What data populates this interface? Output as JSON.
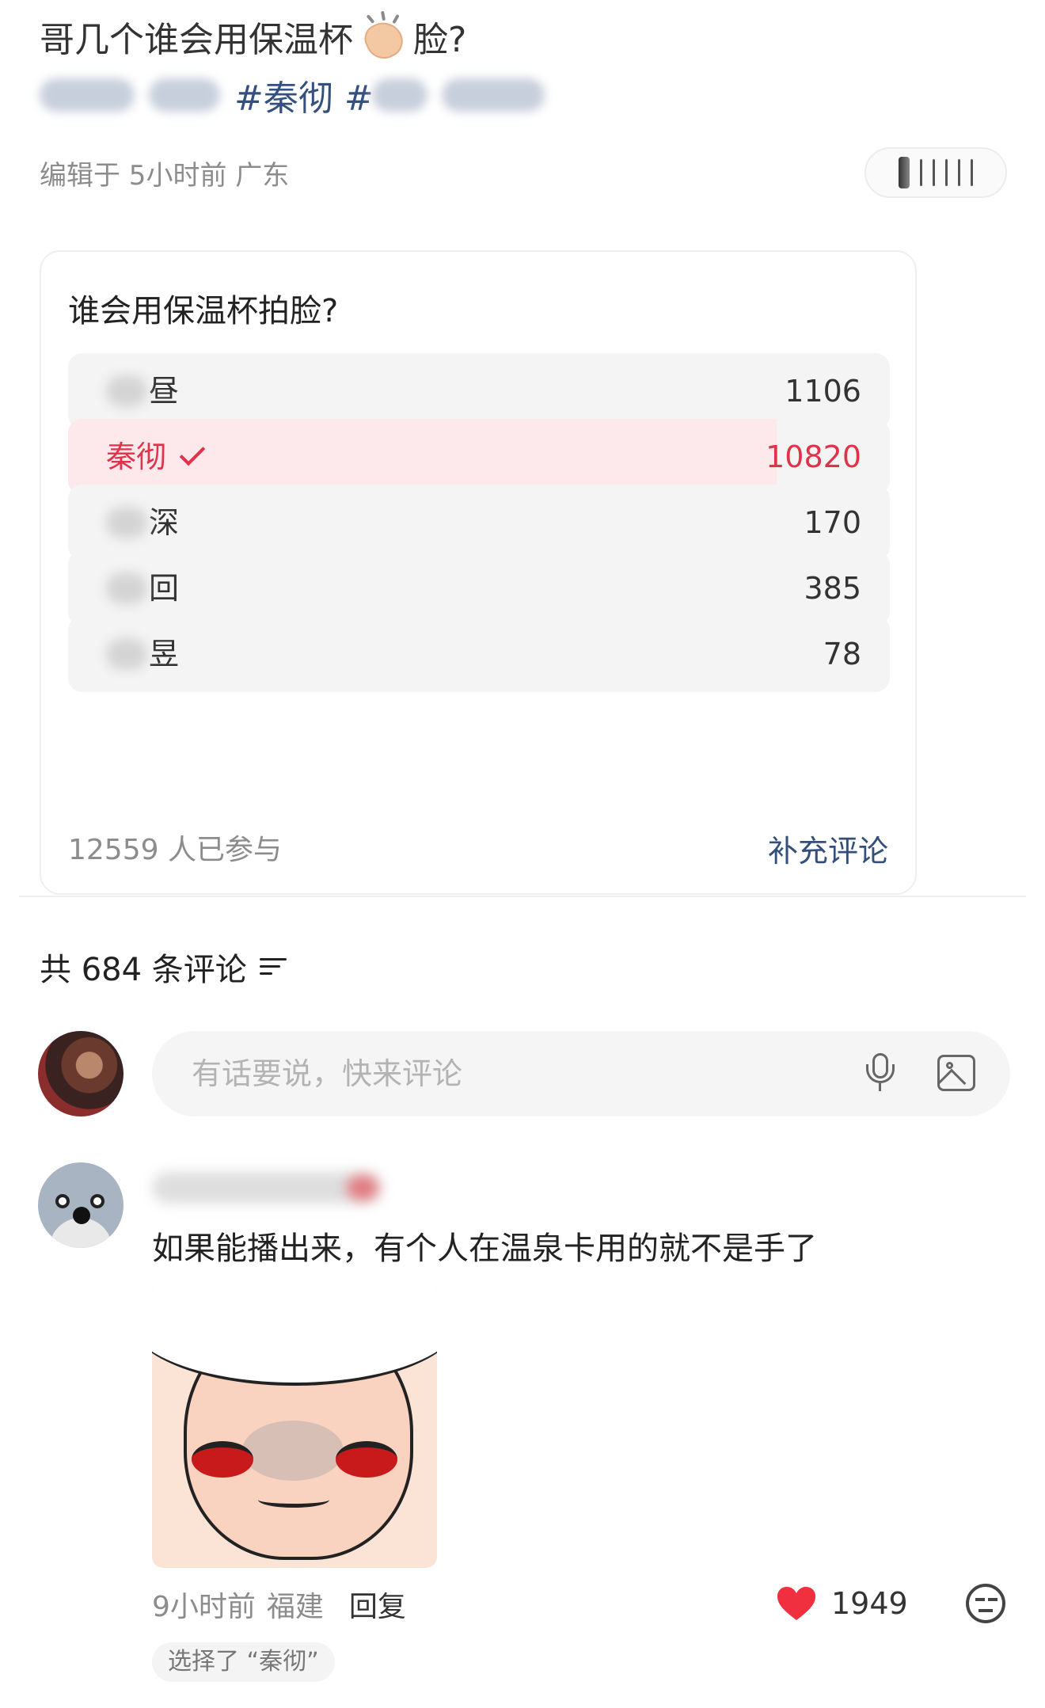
{
  "post": {
    "title_before": "哥几个谁会用保温杯",
    "title_icon": "clapping-hands-emoji",
    "title_after": "脸?",
    "tag_visible": "#秦彻 #",
    "edit_meta": "编辑于 5小时前 广东"
  },
  "poll": {
    "question": "谁会用保温杯拍脸?",
    "options": [
      {
        "label": "昼",
        "count": "1106",
        "selected": false,
        "fraction": 0.088
      },
      {
        "label": "秦彻",
        "count": "10820",
        "selected": true,
        "fraction": 0.862
      },
      {
        "label": "深",
        "count": "170",
        "selected": false,
        "fraction": 0.014
      },
      {
        "label": "回",
        "count": "385",
        "selected": false,
        "fraction": 0.031
      },
      {
        "label": "昱",
        "count": "78",
        "selected": false,
        "fraction": 0.006
      }
    ],
    "participants": "12559 人已参与",
    "supplement_link": "补充评论"
  },
  "comments": {
    "header": "共 684 条评论",
    "input_placeholder": "有话要说，快来评论",
    "items": [
      {
        "text": "如果能播出来，有个人在温泉卡用的就不是手了",
        "time": "9小时前",
        "location": "福建",
        "reply_label": "回复",
        "likes": "1949",
        "choice_badge": "选择了 “秦彻”"
      }
    ]
  },
  "colors": {
    "accent_red": "#e0334a",
    "selected_fill": "#fde8ec",
    "link_blue": "#33507c",
    "tag_blue": "#34507f"
  }
}
